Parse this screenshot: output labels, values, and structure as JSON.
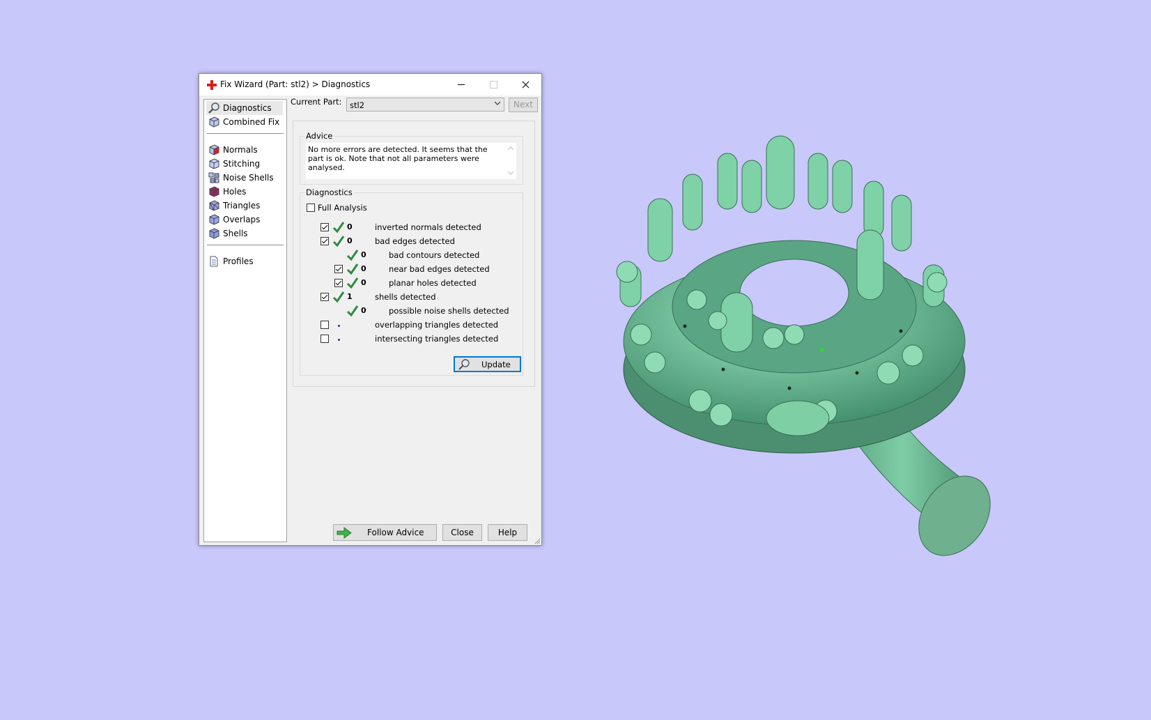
{
  "window": {
    "title": "Fix Wizard (Part: stl2) > Diagnostics"
  },
  "nav": {
    "top": [
      {
        "label": "Diagnostics",
        "icon": "magnifier-icon",
        "selected": true
      },
      {
        "label": "Combined Fix",
        "icon": "cube-icon"
      }
    ],
    "tools": [
      {
        "label": "Normals",
        "icon": "normals-cube-icon"
      },
      {
        "label": "Stitching",
        "icon": "stitching-cube-icon"
      },
      {
        "label": "Noise Shells",
        "icon": "noise-shells-icon"
      },
      {
        "label": "Holes",
        "icon": "holes-cube-icon"
      },
      {
        "label": "Triangles",
        "icon": "triangles-cube-icon"
      },
      {
        "label": "Overlaps",
        "icon": "overlaps-cube-icon"
      },
      {
        "label": "Shells",
        "icon": "shells-cube-icon"
      }
    ],
    "bottom": [
      {
        "label": "Profiles",
        "icon": "document-icon"
      }
    ]
  },
  "current_part": {
    "label": "Current Part:",
    "value": "stl2"
  },
  "next_label": "Next",
  "advice": {
    "title": "Advice",
    "text": "No more errors are detected. It seems that the part is ok. Note that not all parameters were analysed."
  },
  "diagnostics": {
    "title": "Diagnostics",
    "full_analysis_label": "Full Analysis",
    "rows": [
      {
        "checkbox": true,
        "checked": true,
        "tick": true,
        "value": "0",
        "label": "inverted normals detected",
        "indent": 0
      },
      {
        "checkbox": true,
        "checked": true,
        "tick": true,
        "value": "0",
        "label": "bad edges detected",
        "indent": 0
      },
      {
        "checkbox": false,
        "checked": false,
        "tick": true,
        "value": "0",
        "label": "bad contours detected",
        "indent": 1
      },
      {
        "checkbox": true,
        "checked": true,
        "tick": true,
        "value": "0",
        "label": "near bad edges detected",
        "indent": 1
      },
      {
        "checkbox": true,
        "checked": true,
        "tick": true,
        "value": "0",
        "label": "planar holes detected",
        "indent": 1
      },
      {
        "checkbox": true,
        "checked": true,
        "tick": true,
        "value": "1",
        "label": "shells detected",
        "indent": 0
      },
      {
        "checkbox": false,
        "checked": false,
        "tick": true,
        "value": "0",
        "label": "possible noise shells detected",
        "indent": 1
      },
      {
        "checkbox": true,
        "checked": false,
        "tick": false,
        "value": "",
        "label": "overlapping triangles detected",
        "indent": 0
      },
      {
        "checkbox": true,
        "checked": false,
        "tick": false,
        "value": "",
        "label": "intersecting triangles detected",
        "indent": 0
      }
    ],
    "update_label": "Update"
  },
  "footer": {
    "follow_advice": "Follow Advice",
    "close": "Close",
    "help": "Help"
  },
  "colors": {
    "background": "#c9c8fa",
    "model": "#5fae8a",
    "tick": "#2e8b40",
    "focus": "#0078d7"
  }
}
